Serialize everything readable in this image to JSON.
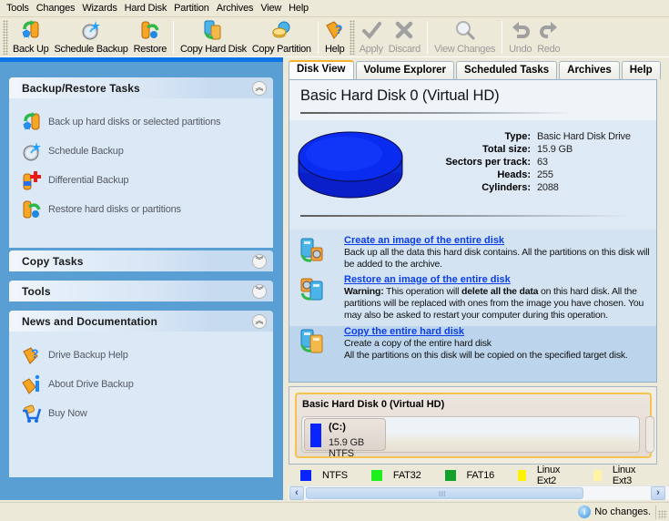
{
  "menu": [
    "Tools",
    "Changes",
    "Wizards",
    "Hard Disk",
    "Partition",
    "Archives",
    "View",
    "Help"
  ],
  "toolbar": {
    "groups": [
      [
        {
          "label": "Back Up",
          "icon": "backup-icon",
          "enabled": true
        },
        {
          "label": "Schedule Backup",
          "icon": "schedule-backup-icon",
          "enabled": true
        },
        {
          "label": "Restore",
          "icon": "restore-icon",
          "enabled": true
        }
      ],
      [
        {
          "label": "Copy Hard Disk",
          "icon": "copy-hard-disk-icon",
          "enabled": true
        },
        {
          "label": "Copy Partition",
          "icon": "copy-partition-icon",
          "enabled": true
        }
      ],
      [
        {
          "label": "Help",
          "icon": "help-icon",
          "enabled": true
        }
      ],
      [
        {
          "label": "Apply",
          "icon": "checkmark-icon",
          "enabled": false
        },
        {
          "label": "Discard",
          "icon": "x-icon",
          "enabled": false
        }
      ],
      [
        {
          "label": "View Changes",
          "icon": "magnifier-icon",
          "enabled": false
        }
      ],
      [
        {
          "label": "Undo",
          "icon": "undo-icon",
          "enabled": false
        },
        {
          "label": "Redo",
          "icon": "redo-icon",
          "enabled": false
        }
      ]
    ]
  },
  "sidebar": {
    "panels": [
      {
        "title": "Backup/Restore Tasks",
        "expanded": true,
        "items": [
          {
            "label": "Back up hard disks or selected partitions",
            "icon": "backup-icon"
          },
          {
            "label": "Schedule Backup",
            "icon": "schedule-backup-icon"
          },
          {
            "label": "Differential Backup",
            "icon": "differential-backup-icon"
          },
          {
            "label": "Restore hard disks or partitions",
            "icon": "restore-icon"
          }
        ]
      },
      {
        "title": "Copy Tasks",
        "expanded": false,
        "items": []
      },
      {
        "title": "Tools",
        "expanded": false,
        "items": []
      },
      {
        "title": "News and Documentation",
        "expanded": true,
        "items": [
          {
            "label": "Drive Backup Help",
            "icon": "help-book-icon"
          },
          {
            "label": "About Drive Backup",
            "icon": "info-book-icon"
          },
          {
            "label": "Buy Now",
            "icon": "cart-icon"
          }
        ]
      }
    ]
  },
  "tabs": [
    {
      "label": "Disk View",
      "active": true
    },
    {
      "label": "Volume Explorer",
      "active": false
    },
    {
      "label": "Scheduled Tasks",
      "active": false
    },
    {
      "label": "Archives",
      "active": false
    },
    {
      "label": "Help",
      "active": false
    }
  ],
  "disk": {
    "title": "Basic Hard Disk 0 (Virtual HD)",
    "color": "#0a2cf0",
    "properties": [
      {
        "key": "Type:",
        "value": "Basic Hard Disk Drive"
      },
      {
        "key": "Total size:",
        "value": "15.9 GB"
      },
      {
        "key": "Sectors per track:",
        "value": "63"
      },
      {
        "key": "Heads:",
        "value": "255"
      },
      {
        "key": "Cylinders:",
        "value": "2088"
      }
    ],
    "actions": [
      {
        "link": "Create an image of the entire disk",
        "desc_parts": [
          {
            "text": "Back up all the data this hard disk contains. All the partitions on this disk will be added to the archive.",
            "bold": false
          }
        ]
      },
      {
        "link": "Restore an image of the entire disk",
        "desc_parts": [
          {
            "text": "Warning:",
            "bold": true
          },
          {
            "text": " This operation will ",
            "bold": false
          },
          {
            "text": "delete all the data",
            "bold": true
          },
          {
            "text": " on this hard disk. All the partitions will be replaced with ones from the image you have chosen. You may also be asked to restart your computer during this operation.",
            "bold": false
          }
        ]
      },
      {
        "link": "Copy the entire hard disk",
        "desc_lines": [
          "Create a copy of the entire hard disk",
          "All the partitions on this disk will be copied on the specified target disk."
        ]
      }
    ]
  },
  "diskmap": {
    "title": "Basic Hard Disk 0 (Virtual HD)",
    "partitions": [
      {
        "name": "(C:)",
        "size": "15.9 GB NTFS",
        "color": "#0a24ff"
      }
    ]
  },
  "legend": [
    {
      "label": "NTFS",
      "color": "#0a24ff"
    },
    {
      "label": "FAT32",
      "color": "#1ef01e"
    },
    {
      "label": "FAT16",
      "color": "#12a12a"
    },
    {
      "label": "Linux Ext2",
      "color": "#fff200"
    },
    {
      "label": "Linux Ext3",
      "color": "#fff3a6"
    }
  ],
  "status": {
    "text": "No changes."
  }
}
